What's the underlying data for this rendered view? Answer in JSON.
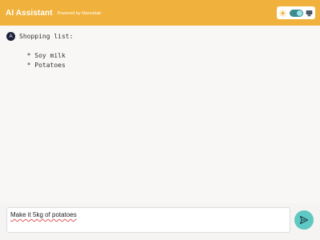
{
  "header": {
    "title": "AI Assistant",
    "subtitle": "Powered by Mannelab"
  },
  "theme_toggle": {
    "left_icon": "sun-icon",
    "right_icon": "monitor-icon",
    "state": "on"
  },
  "chat": {
    "messages": [
      {
        "avatar": "A",
        "lines": [
          "Shopping list:",
          "",
          "  * Soy milk",
          "  * Potatoes"
        ]
      }
    ]
  },
  "composer": {
    "input_value": "Make it 5kg of potatoes",
    "send_icon": "send-icon"
  },
  "colors": {
    "header_bg": "#f0b23c",
    "send_button": "#5ec8c3",
    "avatar_bg": "#1b1f3b"
  }
}
